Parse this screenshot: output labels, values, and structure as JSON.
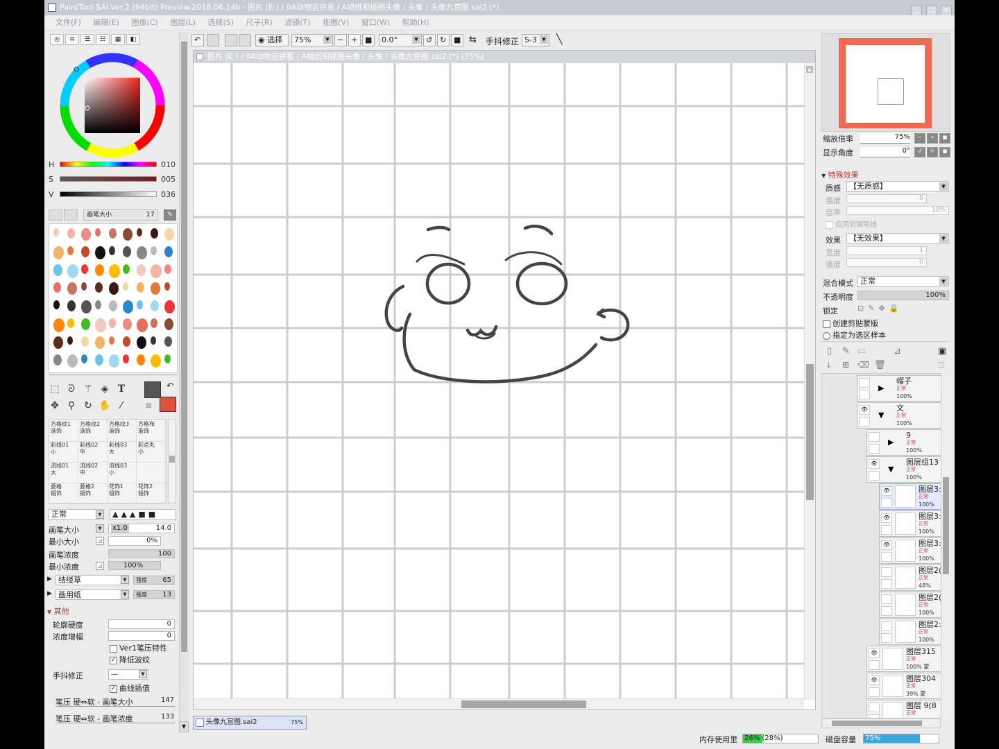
{
  "window": {
    "title": "PaintTool SAI Ver.2 (64bit) Preview.2018.06.14b - 图片 (E:) / 0A动物运拼看 / A描纸和插图头像 / 头像 / 头像九宫图.sai2 (*)",
    "buttons": [
      "_",
      "□",
      "×"
    ]
  },
  "menu": [
    "文件(F)",
    "编辑(E)",
    "图像(C)",
    "图层(L)",
    "选择(S)",
    "尺子(R)",
    "滤镜(T)",
    "视图(V)",
    "窗口(W)",
    "帮助(H)"
  ],
  "color_panel": {
    "h_label": "H",
    "h_value": "010",
    "s_label": "S",
    "s_value": "005",
    "v_label": "V",
    "v_value": "036",
    "brush_size_label": "画笔大小",
    "brush_size_value": "17",
    "primary_color": "#555555",
    "secondary_color": "#e0523a"
  },
  "tools": {
    "text_tool": "T"
  },
  "brushes": [
    [
      "方格纹1\n渐饰",
      "方格纹2\n渐饰",
      "方格纹3\n渐饰",
      "方格布\n渐饰"
    ],
    [
      "彩线01\n小",
      "彩线02\n中",
      "彩线03\n大",
      "彩点丸\n小"
    ],
    [
      "流线01\n大",
      "流线02\n中",
      "流线03\n小",
      ""
    ],
    [
      "菱格\n镜饰",
      "菱格2\n镜饰",
      "花饰1\n镜饰",
      "花饰2\n镜饰"
    ]
  ],
  "brush_params": {
    "blend_mode": "正常",
    "size_label": "画笔大小",
    "size_mult": "x1.0",
    "size_value": "14.0",
    "min_size_label": "最小大小",
    "min_size_value": "0%",
    "density_label": "画笔浓度",
    "density_value": "100",
    "min_density_label": "最小浓度",
    "min_density_value": "100%",
    "texture1_name": "结缕草",
    "texture1_label": "强度",
    "texture1_value": "65",
    "texture2_name": "画用纸",
    "texture2_label": "强度",
    "texture2_value": "13",
    "other_label": "其他",
    "edge_hardness_label": "轮廓硬度",
    "edge_hardness_value": "0",
    "density_gain_label": "浓度增幅",
    "density_gain_value": "0",
    "ver1_label": "Ver1笔压特性",
    "reduce_ripple_label": "降低波纹",
    "stabilizer_label": "手抖修正",
    "stabilizer_value": "—",
    "curve_interp_label": "曲线插值",
    "pressure_size_label": "笔压 硬⇔软 - 画笔大小",
    "pressure_size_value": "147",
    "pressure_density_label": "笔压 硬⇔软 - 画笔浓度",
    "pressure_density_value": "133"
  },
  "toolbar": {
    "select_label": "选择",
    "zoom_value": "75%",
    "angle_value": "0.0°",
    "stabilizer_label": "手抖修正",
    "stabilizer_value": "S-3"
  },
  "canvas": {
    "title": "图片 (E:) / 0A动物运拼看 / A描纸和插图头像 / 头像 / 头像九宫图.sai2 (*) (75%)"
  },
  "document_tab": {
    "name": "头像九宫图.sai2",
    "zoom": "75%"
  },
  "navigator": {
    "zoom_label": "缩放倍率",
    "zoom_value": "75%",
    "angle_label": "显示角度",
    "angle_value": "0°"
  },
  "effects": {
    "header": "特殊效果",
    "texture_label": "质感",
    "texture_value": "【无质感】",
    "strength_label": "强度",
    "strength_value": "0",
    "scale_label": "倍率",
    "scale_value": "10%",
    "apply_pen_label": "应用到钢笔线",
    "effect_label": "效果",
    "effect_value": "【无效果】",
    "width_label": "宽度",
    "width_value": "1",
    "strength2_label": "强度",
    "strength2_value": "0"
  },
  "layer_props": {
    "blend_label": "混合模式",
    "blend_value": "正常",
    "opacity_label": "不透明度",
    "opacity_value": "100%",
    "lock_label": "锁定",
    "clip_label": "创建剪贴蒙版",
    "ref_label": "指定为选区样本"
  },
  "layers": [
    {
      "name": "帽子",
      "mode": "正常",
      "opacity": "100%",
      "type": "folder",
      "indent": 0,
      "visible": false
    },
    {
      "name": "文",
      "mode": "正常",
      "opacity": "100%",
      "type": "folder-open",
      "indent": 0,
      "visible": true
    },
    {
      "name": "9",
      "mode": "正常",
      "opacity": "100%",
      "type": "folder",
      "indent": 1,
      "visible": false
    },
    {
      "name": "图层组13",
      "mode": "正常",
      "opacity": "100%",
      "type": "folder-open",
      "indent": 1,
      "visible": true
    },
    {
      "name": "图层3:",
      "mode": "正常",
      "opacity": "100%",
      "type": "layer",
      "indent": 2,
      "visible": true,
      "selected": true
    },
    {
      "name": "图层3:",
      "mode": "正常",
      "opacity": "100%",
      "type": "layer",
      "indent": 2,
      "visible": true
    },
    {
      "name": "图层3:",
      "mode": "正常",
      "opacity": "100%",
      "type": "layer",
      "indent": 2,
      "visible": true
    },
    {
      "name": "图层2(",
      "mode": "正常",
      "opacity": "48%",
      "type": "layer",
      "indent": 2,
      "visible": false
    },
    {
      "name": "图层2(",
      "mode": "正常",
      "opacity": "100%",
      "type": "layer",
      "indent": 2,
      "visible": false
    },
    {
      "name": "图层2:",
      "mode": "正常",
      "opacity": "100%",
      "type": "layer",
      "indent": 2,
      "visible": false
    },
    {
      "name": "图层315",
      "mode": "正常",
      "opacity": "100% 蒙",
      "type": "layer",
      "indent": 1,
      "visible": true
    },
    {
      "name": "图层304",
      "mode": "正常",
      "opacity": "39% 蒙",
      "type": "layer",
      "indent": 1,
      "visible": true
    },
    {
      "name": "图层 9(8",
      "mode": "正常",
      "opacity": "",
      "type": "layer",
      "indent": 1,
      "visible": false
    }
  ],
  "status": {
    "memory_label": "内存使用里",
    "memory_value": "26% (28%)",
    "memory_fraction": 0.26,
    "disk_label": "磁盘容量",
    "disk_value": "75%",
    "disk_fraction": 0.75
  }
}
